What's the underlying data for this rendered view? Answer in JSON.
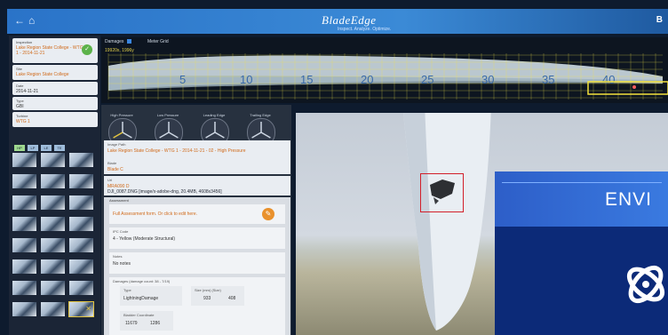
{
  "header": {
    "back_icon": "arrow-left-icon",
    "home_icon": "home-icon",
    "brand": "BladeEdge",
    "brand_tagline": "Inspect. Analyze. Optimize.",
    "right_label": "B"
  },
  "left_panel": {
    "inspection_label": "Inspection",
    "inspection_value": "Lake Region State College - WTG 1 - 2014-11-21",
    "inspection_badge": "✓",
    "site_label": "Site",
    "site_value": "Lake Region State College",
    "date_label": "Date",
    "date_value": "2014-11-21",
    "type_label": "Type",
    "type_value": "GBI",
    "turbine_label": "Turbine",
    "turbine_value": "WTG 1",
    "chips": [
      "HP",
      "LP",
      "LE",
      "TE"
    ],
    "thumbnail_count": 24
  },
  "chart": {
    "damages_label": "Damages",
    "damages_checked": true,
    "meter_grid_label": "Meter Grid",
    "coord_readout": "19920x, 1996y",
    "tick_labels": [
      "5",
      "10",
      "15",
      "20",
      "25",
      "30",
      "35",
      "40"
    ],
    "colors": {
      "grid": "#f0e24a",
      "blade": "#c9d7de",
      "highlight": "#f4e23c"
    }
  },
  "views": {
    "labels": [
      "High Pressure",
      "Low Pressure",
      "Leading Edge",
      "Trailing Edge"
    ]
  },
  "details": {
    "image_path_label": "Image Path",
    "image_path_value": "Lake Region State College - WTG 1 - 2014-11-21 - 02 - High Pressure",
    "blade_label": "Blade",
    "blade_value": "Blade C",
    "url_label": "Url",
    "url_value": "MRA090 D",
    "filename_value": "DJI_0087.DNG [image/x-adobe-dng, 20.4MB, 4608x3456]"
  },
  "assessment": {
    "title": "Assessment",
    "full_assessment_text": "Full Assessment form. Or click to edit here.",
    "edit_icon": "pencil-icon",
    "ipc_label": "IPC Code",
    "ipc_value": "4 - Yellow (Moderate Structural)",
    "notes_label": "Notes",
    "notes_value": "No notes",
    "damages_label": "Damages (damage count: 38 - 7/19)",
    "type_label": "Type",
    "type_value": "LightningDamage",
    "size_label": "Size (mm) (Size)",
    "size_w": "933",
    "size_h": "408",
    "coords_label": "Bladder Coordinate",
    "coord_x": "11679",
    "coord_y": "1286"
  },
  "ad": {
    "text": "ENVI",
    "icon": "atom-logo-icon"
  }
}
